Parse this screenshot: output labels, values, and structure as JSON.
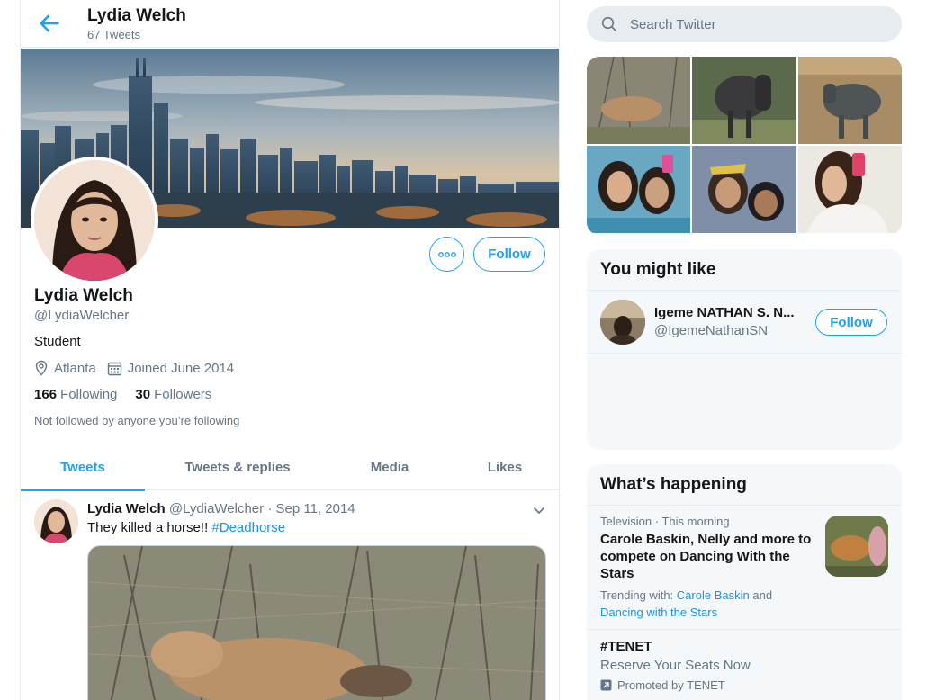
{
  "header": {
    "name": "Lydia Welch",
    "tweet_count": "67 Tweets"
  },
  "profile": {
    "name": "Lydia Welch",
    "handle": "@LydiaWelcher",
    "bio": "Student",
    "location": "Atlanta",
    "joined": "Joined June 2014",
    "following_count": "166",
    "following_label": "Following",
    "followers_count": "30",
    "followers_label": "Followers",
    "followed_note": "Not followed by anyone you’re following",
    "follow_label": "Follow"
  },
  "tabs": [
    {
      "label": "Tweets",
      "active": true
    },
    {
      "label": "Tweets & replies",
      "active": false
    },
    {
      "label": "Media",
      "active": false
    },
    {
      "label": "Likes",
      "active": false
    }
  ],
  "tweet": {
    "name": "Lydia Welch",
    "handle": "@LydiaWelcher",
    "date": "· Sep 11, 2014",
    "text": "They killed a horse!!",
    "hashtag": "#Deadhorse"
  },
  "sidebar": {
    "search_placeholder": "Search Twitter",
    "you_might_like": {
      "title": "You might like",
      "user": {
        "name": "Igeme NATHAN S. N...",
        "handle": "@IgemeNathanSN",
        "follow_label": "Follow"
      }
    },
    "whats_happening": {
      "title": "What’s happening",
      "trends": [
        {
          "category": "Television",
          "time": "This morning",
          "title": "Carole Baskin, Nelly and more to compete on Dancing With the Stars",
          "trending_with_label": "Trending with:",
          "link1": "Carole Baskin",
          "conj": "and",
          "link2": "Dancing with the Stars"
        },
        {
          "tag": "#TENET",
          "text": "Reserve Your Seats Now",
          "promo": "Promoted by TENET"
        }
      ]
    }
  },
  "colors": {
    "accent": "#1da1f2",
    "secondary_text": "#657786",
    "border": "#e6ecf0",
    "card_bg": "#f5f8fa"
  }
}
